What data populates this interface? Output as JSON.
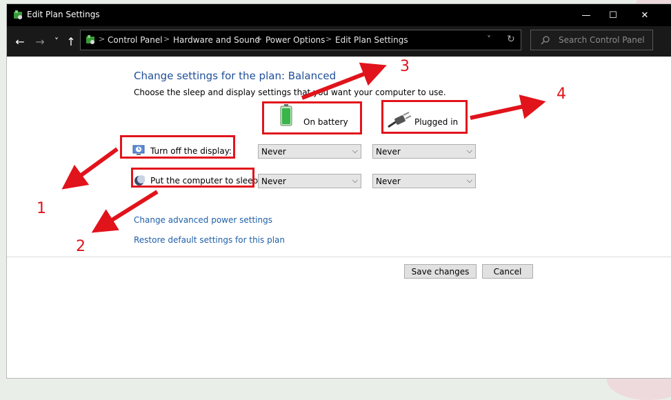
{
  "window": {
    "title": "Edit Plan Settings",
    "controls": {
      "minimize": "—",
      "maximize": "☐",
      "close": "✕"
    }
  },
  "nav": {
    "back": "←",
    "forward": "→",
    "recent": "˅",
    "up": "↑",
    "breadcrumbs": [
      "Control Panel",
      "Hardware and Sound",
      "Power Options",
      "Edit Plan Settings"
    ],
    "separator": ">",
    "dropdown": "˅",
    "refresh": "↻",
    "search_placeholder": "Search Control Panel"
  },
  "main": {
    "heading": "Change settings for the plan: Balanced",
    "subtext": "Choose the sleep and display settings that you want your computer to use.",
    "columns": {
      "battery": "On battery",
      "plugged": "Plugged in"
    },
    "rows": [
      {
        "label": "Turn off the display:",
        "battery": "Never",
        "plugged": "Never"
      },
      {
        "label": "Put the computer to sleep:",
        "battery": "Never",
        "plugged": "Never"
      }
    ],
    "links": {
      "advanced": "Change advanced power settings",
      "restore": "Restore default settings for this plan"
    },
    "buttons": {
      "save": "Save changes",
      "cancel": "Cancel"
    }
  },
  "annotations": {
    "color": "#e1131b",
    "numbers": [
      "1",
      "2",
      "3",
      "4"
    ]
  }
}
